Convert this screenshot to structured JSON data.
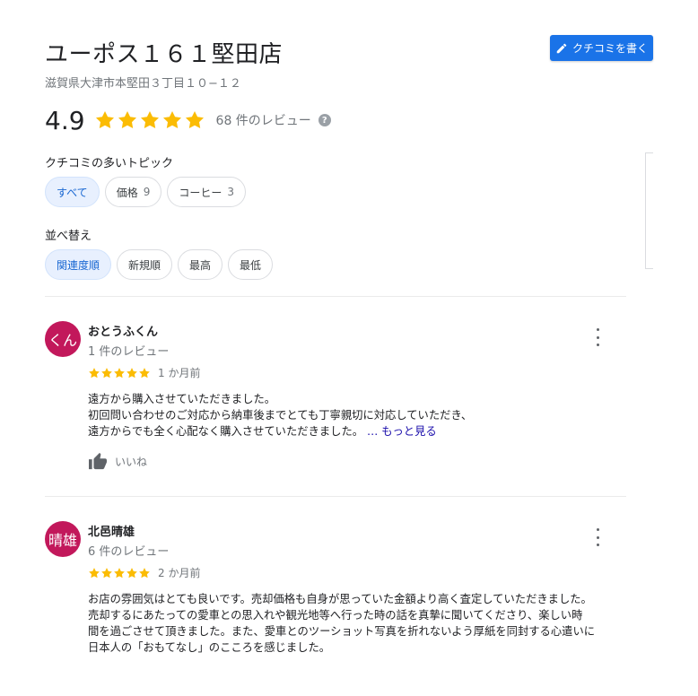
{
  "place": {
    "title": "ユーポス１６１堅田店",
    "address": "滋賀県大津市本堅田３丁目１０−１２",
    "rating": "4.9",
    "review_count": "68 件のレビュー",
    "help_glyph": "?"
  },
  "write_review_button": "クチコミを書く",
  "topics": {
    "label": "クチコミの多いトピック",
    "chips": [
      {
        "label": "すべて",
        "count": ""
      },
      {
        "label": "価格",
        "count": "9"
      },
      {
        "label": "コーヒー",
        "count": "3"
      }
    ]
  },
  "sort": {
    "label": "並べ替え",
    "chips": [
      "関連度順",
      "新規順",
      "最高",
      "最低"
    ]
  },
  "reviews": [
    {
      "avatar_text": "くん",
      "name": "おとうふくん",
      "count": "1 件のレビュー",
      "stars": 5,
      "date": "1 か月前",
      "lines": [
        "遠方から購入させていただきました。",
        "初回問い合わせのご対応から納車後までとても丁寧親切に対応していただき、",
        "遠方からでも全く心配なく購入させていただきました。"
      ],
      "more_label": "… もっと見る",
      "like_label": "いいね"
    },
    {
      "avatar_text": "晴雄",
      "name": "北邑晴雄",
      "count": "6 件のレビュー",
      "stars": 5,
      "date": "2 か月前",
      "lines": [
        "お店の雰囲気はとても良いです。売却価格も自身が思っていた金額より高く査定していただきました。",
        "売却するにあたっての愛車との思入れや観光地等へ行った時の話を真摯に聞いてくださり、楽しい時",
        "間を過ごさせて頂きました。また、愛車とのツーショット写真を折れないよう厚紙を同封する心遣いに",
        "日本人の「おもてなし」のこころを感じました。"
      ]
    }
  ],
  "colors": {
    "accent": "#1a73e8",
    "star": "#fbbc04",
    "avatar": "#c2185b",
    "link": "#1a0dab"
  }
}
